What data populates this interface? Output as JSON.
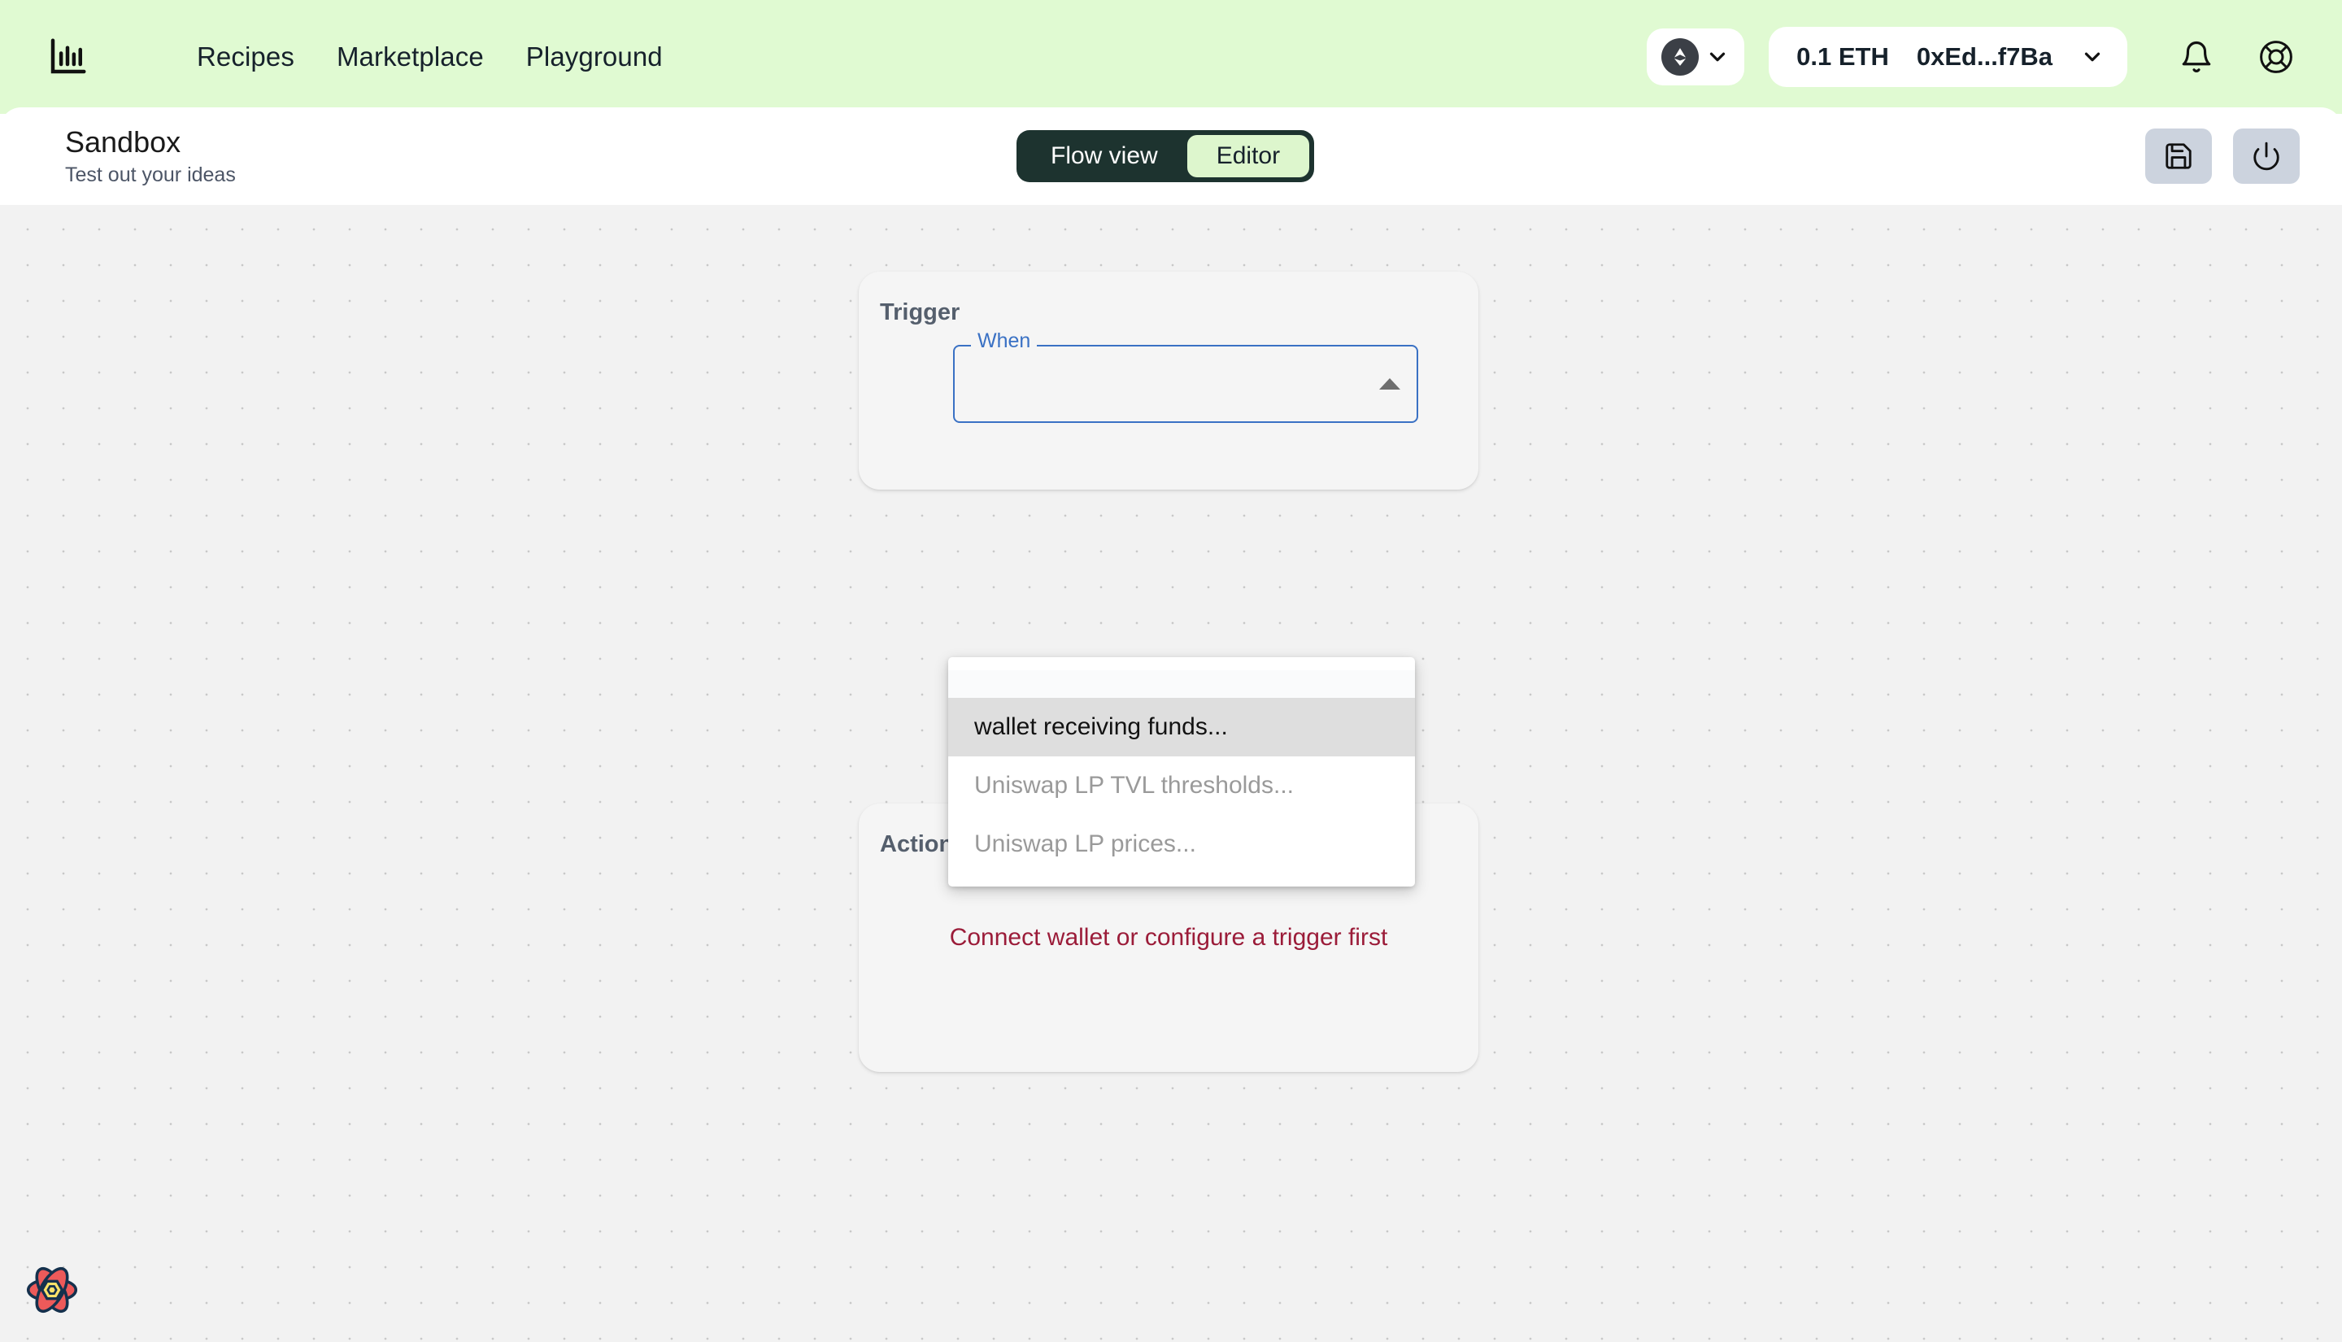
{
  "header": {
    "logo_icon": "bar-chart-logo-icon",
    "nav": [
      {
        "label": "Recipes"
      },
      {
        "label": "Marketplace"
      },
      {
        "label": "Playground"
      }
    ],
    "network_selector": {
      "icon": "ethereum-icon",
      "chevron": "chevron-down-icon"
    },
    "wallet": {
      "balance": "0.1 ETH",
      "address": "0xEd...f7Ba",
      "chevron": "chevron-down-icon"
    },
    "notifications_icon": "bell-icon",
    "support_icon": "lifebuoy-icon",
    "background_color": "#e0fad2"
  },
  "toolbar": {
    "title": "Sandbox",
    "subtitle": "Test out your ideas",
    "view_toggle": {
      "options": [
        {
          "label": "Flow view",
          "active": false
        },
        {
          "label": "Editor",
          "active": true
        }
      ],
      "container_color": "#1d332f",
      "active_color": "#ddf6cd"
    },
    "save_icon": "save-floppy-icon",
    "power_icon": "power-icon"
  },
  "canvas": {
    "trigger_card": {
      "heading": "Trigger",
      "select": {
        "label": "When",
        "value": "",
        "arrow_icon": "triangle-up-icon",
        "expanded": true,
        "border_color": "#3a71c4"
      }
    },
    "dropdown": {
      "options": [
        {
          "label": "",
          "state": "empty"
        },
        {
          "label": "wallet receiving funds...",
          "state": "selected"
        },
        {
          "label": "Uniswap LP TVL thresholds...",
          "state": "disabled"
        },
        {
          "label": "Uniswap LP prices...",
          "state": "disabled"
        }
      ]
    },
    "connector_icon": "chevron-down-icon",
    "actions_card": {
      "heading": "Actions",
      "empty_message": "Connect wallet or configure a trigger first",
      "empty_message_color": "#9b1c39"
    },
    "watermark_icon": "atom-flower-logo-icon",
    "background_color": "#f2f2f2"
  }
}
